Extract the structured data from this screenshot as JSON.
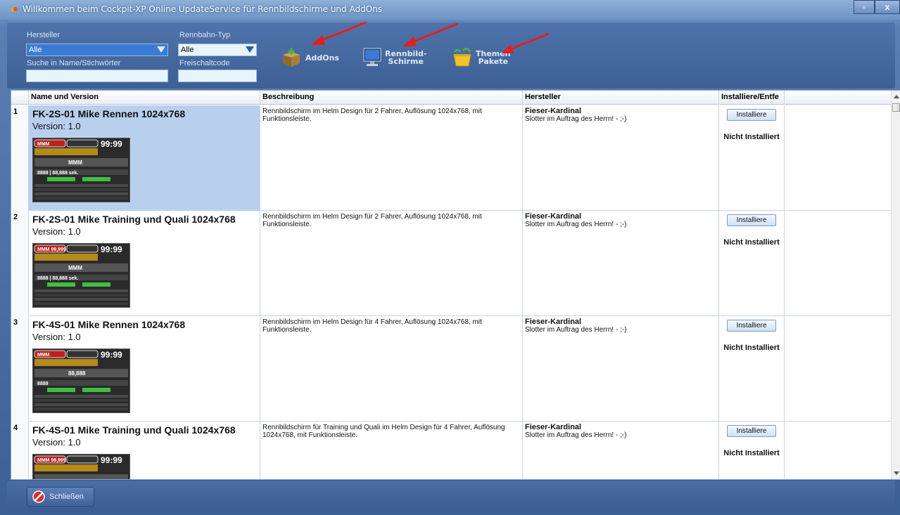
{
  "window": {
    "title": "Willkommen beim Cockpit-XP Online UpdateService für Rennbildschirme und AddOns",
    "max_glyph": "▫",
    "close_glyph": "x"
  },
  "filters": {
    "hersteller_label": "Hersteller",
    "hersteller_value": "Alle",
    "rennbahn_label": "Rennbahn-Typ",
    "rennbahn_value": "Alle",
    "suche_label": "Suche in Name/Stichwörter",
    "suche_value": "",
    "freischalt_label": "Freischaltcode",
    "freischalt_value": ""
  },
  "toolbar": {
    "addons_label": "AddOns",
    "rennbild_label": "Rennbild-\nSchirme",
    "themen_label": "Themen\nPakete"
  },
  "table": {
    "columns": [
      "",
      "Name und Version",
      "Beschreibung",
      "Hersteller",
      "Installiere/Entfe"
    ],
    "rows": [
      {
        "num": "1",
        "name": "FK-2S-01 Mike Rennen 1024x768",
        "version": "Version: 1.0",
        "description": "Rennbildschirm im Helm Design für 2 Fahrer, Auflösung 1024x768, mit Funktionsleiste.",
        "maker": "Fieser-Kardinal",
        "maker_sub": "Slotter im Auftrag des Herrn! - ;-)",
        "button": "Installiere",
        "status": "Nicht Installiert"
      },
      {
        "num": "2",
        "name": "FK-2S-01 Mike Training und Quali 1024x768",
        "version": "Version: 1.0",
        "description": "Rennbildschirm im Helm Design für 2 Fahrer, Auflösung 1024x768, mit Funktionsleiste.",
        "maker": "Fieser-Kardinal",
        "maker_sub": "Slotter im Auftrag des Herrn! - ;-)",
        "button": "Installiere",
        "status": "Nicht Installiert"
      },
      {
        "num": "3",
        "name": "FK-4S-01 Mike Rennen 1024x768",
        "version": "Version: 1.0",
        "description": "Rennbildschirm im Helm Design für 4 Fahrer, Auflösung 1024x768, mit Funktionsleiste.",
        "maker": "Fieser-Kardinal",
        "maker_sub": "Slotter im Auftrag des Herrn! - ;-)",
        "button": "Installiere",
        "status": "Nicht Installiert"
      },
      {
        "num": "4",
        "name": "FK-4S-01 Mike Training und Quali 1024x768",
        "version": "Version: 1.0",
        "description": "Rennbildschirm für Training und Quali im Helm Design für 4 Fahrer, Auflösung 1024x768, mit Funktionsleiste.",
        "maker": "Fieser-Kardinal",
        "maker_sub": "Slotter im Auftrag des Herrn! - ;-)",
        "button": "Installiere",
        "status": "Nicht Installiert"
      }
    ]
  },
  "thumbnails": [
    {
      "top_left": "MMM",
      "top_right": "99:99",
      "mid": "MMM",
      "stat": "8888 | 88,888 sek."
    },
    {
      "top_left": "MMM 99,999",
      "top_right": "99:99",
      "mid": "MMM",
      "stat": "8888 | 88,888 sek."
    },
    {
      "top_left": "MMM",
      "top_right": "99:99",
      "mid": "88,888",
      "stat": "8888"
    },
    {
      "top_left": "MMM 99,999",
      "top_right": "99:99",
      "mid": "",
      "stat": ""
    }
  ],
  "footer": {
    "close_label": "Schließen"
  },
  "colors": {
    "accent": "#3a7bd5",
    "selected_row": "#b9cfee",
    "arrow": "#e02020"
  }
}
